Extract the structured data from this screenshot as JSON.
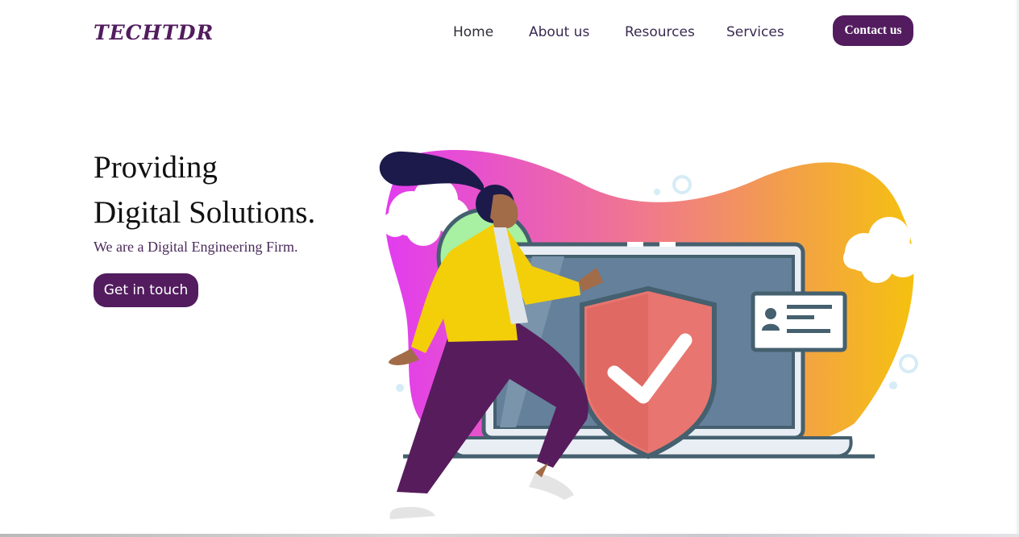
{
  "header": {
    "logo_text": "TECHTDR",
    "nav": [
      {
        "label": "Home"
      },
      {
        "label": "About us"
      },
      {
        "label": "Resources"
      },
      {
        "label": "Services"
      }
    ],
    "contact_label": "Contact us"
  },
  "hero": {
    "title_line1": "Providing",
    "title_line2": "Digital Solutions.",
    "subtitle": "We are a Digital Engineering Firm.",
    "cta_label": "Get in touch"
  },
  "colors": {
    "brand": "#521c5e",
    "blob_gradient": [
      "#e23cf0",
      "#f07a8a",
      "#f5c10f"
    ],
    "shield": "#e8756f",
    "laptop_screen": "#65809a",
    "jacket": "#f3cf0a",
    "pants": "#561c5c"
  },
  "illustration": {
    "icons": [
      "security-shield-icon",
      "check-icon",
      "laptop-icon",
      "id-card-icon",
      "person-icon",
      "cloud-icon"
    ]
  }
}
